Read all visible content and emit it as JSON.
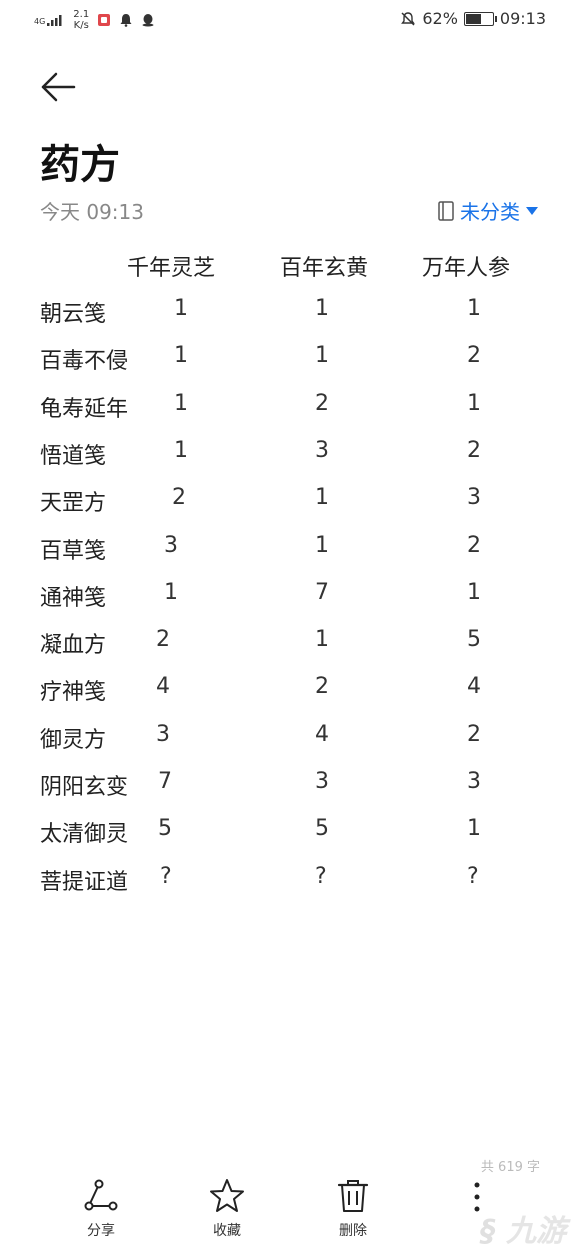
{
  "status_bar": {
    "network": "4G",
    "speed_value": "2.1",
    "speed_unit": "K/s",
    "battery": "62%",
    "battery_level": 0.62,
    "time": "09:13"
  },
  "note": {
    "title": "药方",
    "date": "今天 09:13",
    "category": "未分类"
  },
  "table": {
    "headers": [
      "千年灵芝",
      "百年玄黄",
      "万年人参"
    ],
    "rows": [
      {
        "name": "朝云笺",
        "values": [
          "1",
          "1",
          "1"
        ]
      },
      {
        "name": "百毒不侵",
        "values": [
          "1",
          "1",
          "2"
        ]
      },
      {
        "name": "龟寿延年",
        "values": [
          "1",
          "2",
          "1"
        ]
      },
      {
        "name": "悟道笺",
        "values": [
          "1",
          "3",
          "2"
        ]
      },
      {
        "name": "天罡方",
        "values": [
          "2",
          "1",
          "3"
        ]
      },
      {
        "name": "百草笺",
        "values": [
          "3",
          "1",
          "2"
        ]
      },
      {
        "name": "通神笺",
        "values": [
          "1",
          "7",
          "1"
        ]
      },
      {
        "name": "凝血方",
        "values": [
          "2",
          "1",
          "5"
        ]
      },
      {
        "name": "疗神笺",
        "values": [
          "4",
          "2",
          "4"
        ]
      },
      {
        "name": "御灵方",
        "values": [
          "3",
          "4",
          "2"
        ]
      },
      {
        "name": "阴阳玄变",
        "values": [
          "7",
          "3",
          "3"
        ]
      },
      {
        "name": "太清御灵",
        "values": [
          "5",
          "5",
          "1"
        ]
      },
      {
        "name": "菩提证道",
        "values": [
          "?",
          "?",
          "?"
        ]
      }
    ]
  },
  "word_count": "共 619 字",
  "bottom_bar": {
    "share": "分享",
    "favorite": "收藏",
    "delete": "删除"
  },
  "watermark": "九游",
  "colors": {
    "accent": "#1a73e8"
  }
}
